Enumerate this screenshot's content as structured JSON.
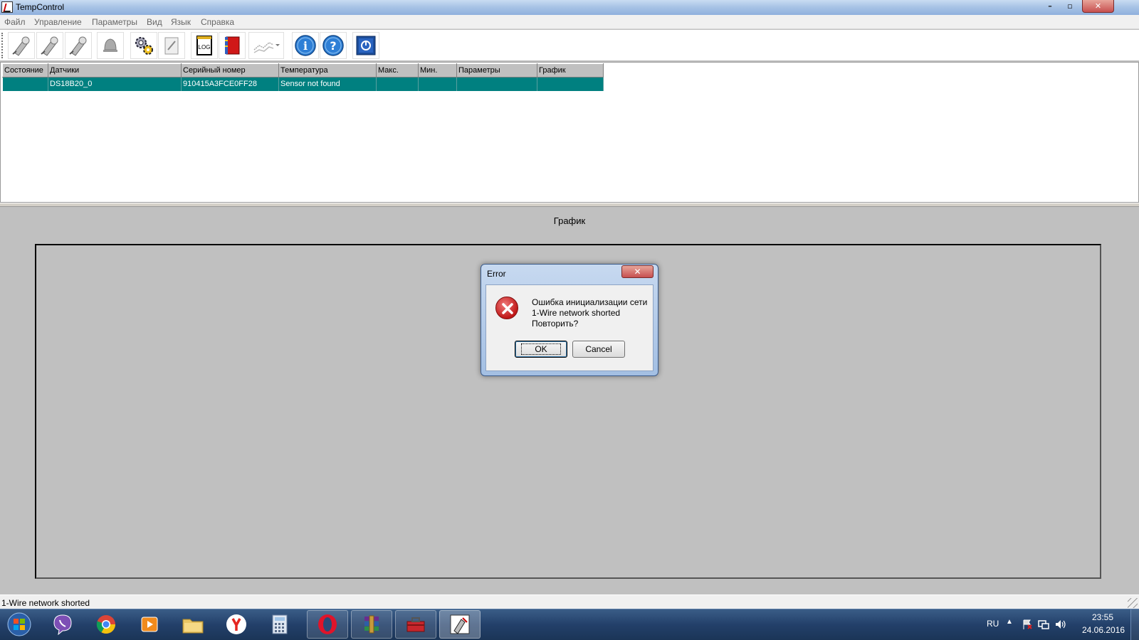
{
  "window": {
    "title": "TempControl",
    "minimize_label": "–",
    "maximize_label": "▫",
    "close_label": "✕"
  },
  "menu": {
    "items": [
      "Файл",
      "Управление",
      "Параметры",
      "Вид",
      "Язык",
      "Справка"
    ]
  },
  "toolbar": {
    "buttons": [
      {
        "icon": "probe-connect-icon"
      },
      {
        "icon": "probe-disconnect-icon"
      },
      {
        "icon": "probe-search-icon"
      },
      {
        "icon": "bell-icon"
      },
      {
        "icon": "settings-gears-icon"
      },
      {
        "icon": "edit-document-icon"
      },
      {
        "icon": "log-file-icon",
        "text": "LOG"
      },
      {
        "icon": "book-icon"
      },
      {
        "icon": "chart-dropdown-icon"
      },
      {
        "icon": "info-icon",
        "text": "i"
      },
      {
        "icon": "help-icon",
        "text": "?"
      },
      {
        "icon": "power-icon"
      }
    ]
  },
  "sensors_table": {
    "columns": [
      "Состояние",
      "Датчики",
      "Серийный номер",
      "Температура",
      "Макс.",
      "Мин.",
      "Параметры",
      "График"
    ],
    "rows": [
      {
        "state": "",
        "sensor": "DS18B20_0",
        "serial": "910415A3FCE0FF28",
        "temperature": "Sensor not found",
        "max": "",
        "min": "",
        "params": "",
        "graph": ""
      }
    ]
  },
  "graph": {
    "title": "График"
  },
  "status": {
    "text": "1-Wire network shorted"
  },
  "dialog": {
    "title": "Error",
    "close_label": "✕",
    "lines": [
      "Ошибка инициализации сети",
      "1-Wire network shorted",
      "Повторить?"
    ],
    "ok_label": "OK",
    "cancel_label": "Cancel",
    "icon": "error-icon"
  },
  "taskbar": {
    "apps": [
      "viber-icon",
      "chrome-icon",
      "media-player-icon",
      "file-explorer-icon",
      "yandex-browser-icon",
      "calculator-icon",
      "opera-icon",
      "winrar-icon",
      "toolbox-icon",
      "tempcontrol-icon"
    ],
    "language": "RU",
    "time": "23:55",
    "date": "24.06.2016"
  },
  "colors": {
    "selected_row": "#008080",
    "panel_gray": "#c0c0c0",
    "taskbar": "#23406a"
  }
}
